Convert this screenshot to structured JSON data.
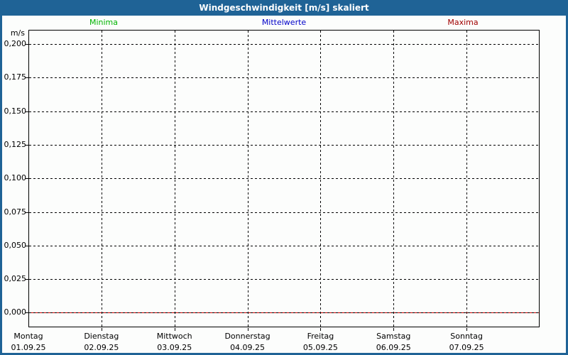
{
  "window": {
    "title": "Windgeschwindigkeit [m/s] skaliert",
    "frame_color": "#1f6396",
    "background_color": "#fcfdfc"
  },
  "legend": [
    {
      "label": "Minima",
      "color": "#00b400"
    },
    {
      "label": "Mittelwerte",
      "color": "#0000c8"
    },
    {
      "label": "Maxima",
      "color": "#a00000"
    }
  ],
  "chart_data": {
    "type": "line",
    "title": "Windgeschwindigkeit [m/s] skaliert",
    "ylabel": "m/s",
    "xlabel": "",
    "ylim": [
      0.0,
      0.2
    ],
    "ytick_step": 0.025,
    "ytick_labels": [
      "0,200",
      "0,175",
      "0,150",
      "0,125",
      "0,100",
      "0,075",
      "0,050",
      "0,025",
      "0,000"
    ],
    "x_categories": [
      {
        "day": "Montag",
        "date": "01.09.25"
      },
      {
        "day": "Dienstag",
        "date": "02.09.25"
      },
      {
        "day": "Mittwoch",
        "date": "03.09.25"
      },
      {
        "day": "Donnerstag",
        "date": "04.09.25"
      },
      {
        "day": "Freitag",
        "date": "05.09.25"
      },
      {
        "day": "Samstag",
        "date": "06.09.25"
      },
      {
        "day": "Sonntag",
        "date": "07.09.25"
      }
    ],
    "grid": true,
    "grid_style": "dashed",
    "grid_color": "#000000",
    "legend_position": "top",
    "zero_line_color": "#d40000",
    "series": [
      {
        "name": "Minima",
        "color": "#00b400",
        "values": [
          0,
          0,
          0,
          0,
          0,
          0,
          0
        ]
      },
      {
        "name": "Mittelwerte",
        "color": "#0000c8",
        "values": [
          0,
          0,
          0,
          0,
          0,
          0,
          0
        ]
      },
      {
        "name": "Maxima",
        "color": "#d40000",
        "values": [
          0,
          0,
          0,
          0,
          0,
          0,
          0
        ]
      }
    ]
  }
}
